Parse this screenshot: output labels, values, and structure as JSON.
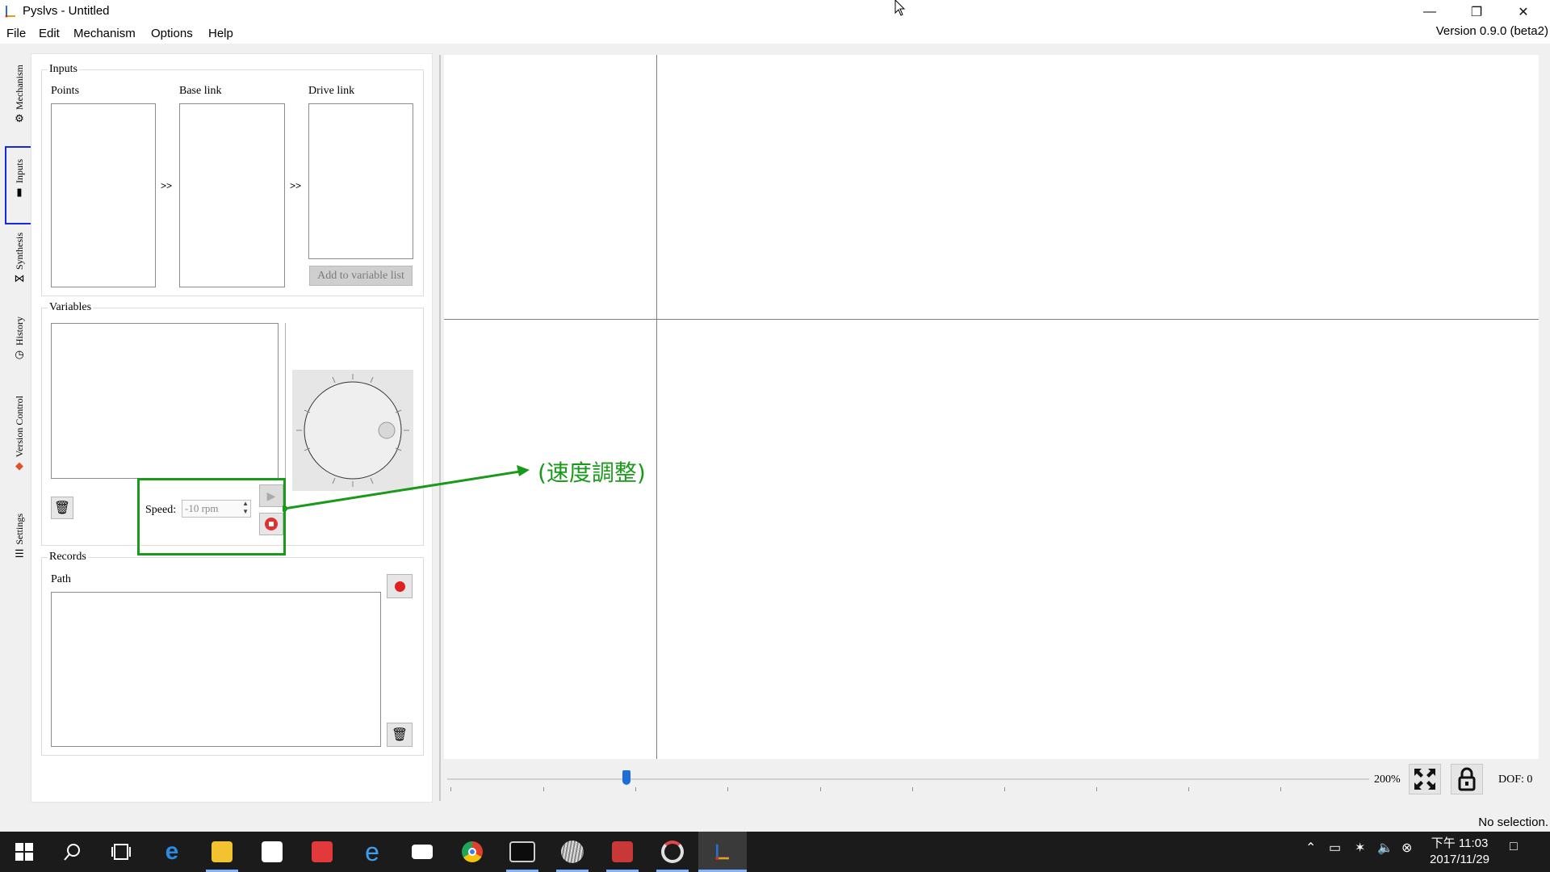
{
  "window": {
    "title": "Pyslvs - Untitled",
    "version": "Version 0.9.0 (beta2)",
    "controls": [
      "minimize-icon",
      "restore-icon",
      "close-icon"
    ]
  },
  "menu": [
    "File",
    "Edit",
    "Mechanism",
    "Options",
    "Help"
  ],
  "side_tabs": [
    {
      "label": "Mechanism",
      "icon": "gear-icon"
    },
    {
      "label": "Inputs",
      "icon": "input-icon",
      "selected": true
    },
    {
      "label": "Synthesis",
      "icon": "synthesis-icon"
    },
    {
      "label": "History",
      "icon": "history-icon"
    },
    {
      "label": "Version Control",
      "icon": "git-icon"
    },
    {
      "label": "Settings",
      "icon": "sliders-icon"
    }
  ],
  "inputs": {
    "group_title": "Inputs",
    "points_label": "Points",
    "base_link_label": "Base link",
    "drive_link_label": "Drive link",
    "arrow1": ">>",
    "arrow2": ">>",
    "add_button": "Add to variable list"
  },
  "variables": {
    "group_title": "Variables",
    "speed_label": "Speed:",
    "speed_value": "-10 rpm"
  },
  "records": {
    "group_title": "Records",
    "path_label": "Path"
  },
  "canvas_toolbar": {
    "slider_value": 0.19,
    "zoom": "200%",
    "dof": "DOF: 0"
  },
  "status": "No selection.",
  "annotation": {
    "text": "(速度調整)",
    "color": "#1a9a1a"
  },
  "taskbar": {
    "time": "下午 11:03",
    "date": "2017/11/29"
  }
}
